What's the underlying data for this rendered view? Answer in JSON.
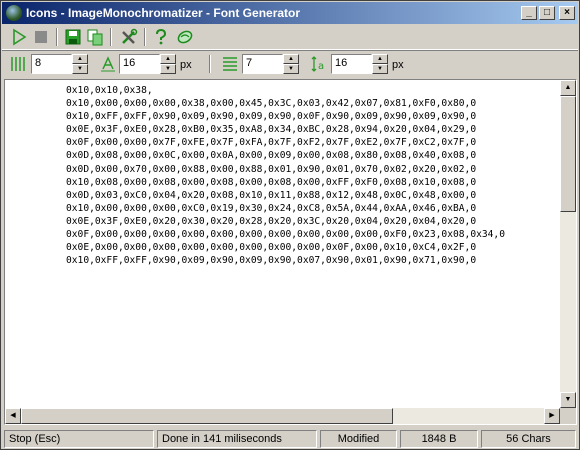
{
  "window": {
    "title": "Icons - ImageMonochromatizer - Font Generator"
  },
  "titlebar_buttons": {
    "minimize": "_",
    "maximize": "□",
    "close": "×"
  },
  "toolbar": {
    "icons": [
      "play-icon",
      "stop-icon",
      "save-icon",
      "copy-icon",
      "tools-icon",
      "help-icon",
      "about-icon"
    ]
  },
  "settings": {
    "width_value": "8",
    "height_value": "16",
    "height_unit": "px",
    "lines_value": "7",
    "spacing_value": "16",
    "spacing_unit": "px"
  },
  "code_lines": [
    "0x10,0x10,0x38,",
    "0x10,0x00,0x00,0x00,0x38,0x00,0x45,0x3C,0x03,0x42,0x07,0x81,0xF0,0x80,0",
    "0x10,0xFF,0xFF,0x90,0x09,0x90,0x09,0x90,0x0F,0x90,0x09,0x90,0x09,0x90,0",
    "0x0E,0x3F,0xE0,0x28,0xB0,0x35,0xA8,0x34,0xBC,0x28,0x94,0x20,0x04,0x29,0",
    "0x0F,0x00,0x00,0x7F,0xFE,0x7F,0xFA,0x7F,0xF2,0x7F,0xE2,0x7F,0xC2,0x7F,0",
    "0x0D,0x08,0x00,0x0C,0x00,0x0A,0x00,0x09,0x00,0x08,0x80,0x08,0x40,0x08,0",
    "0x0D,0x00,0x70,0x00,0x88,0x00,0x88,0x01,0x90,0x01,0x70,0x02,0x20,0x02,0",
    "0x10,0x08,0x00,0x08,0x00,0x08,0x00,0x08,0x00,0xFF,0xF0,0x08,0x10,0x08,0",
    "0x0D,0x03,0xC0,0x04,0x20,0x08,0x10,0x11,0x88,0x12,0x48,0x0C,0x48,0x00,0",
    "0x10,0x00,0x00,0x00,0xC0,0x19,0x30,0x24,0xC8,0x5A,0x44,0xAA,0x46,0xBA,0",
    "0x0E,0x3F,0xE0,0x20,0x30,0x20,0x28,0x20,0x3C,0x20,0x04,0x20,0x04,0x20,0",
    "0x0F,0x00,0x00,0x00,0x00,0x00,0x00,0x00,0x00,0x00,0x00,0xF0,0x23,0x08,0x34,0",
    "0x0E,0x00,0x00,0x00,0x00,0x00,0x00,0x00,0x00,0x0F,0x00,0x10,0xC4,0x2F,0",
    "0x10,0xFF,0xFF,0x90,0x09,0x90,0x09,0x90,0x07,0x90,0x01,0x90,0x71,0x90,0"
  ],
  "status": {
    "action": "Stop (Esc)",
    "message": "Done in 141 miliseconds",
    "state": "Modified",
    "size": "1848 B",
    "chars": "56 Chars"
  }
}
